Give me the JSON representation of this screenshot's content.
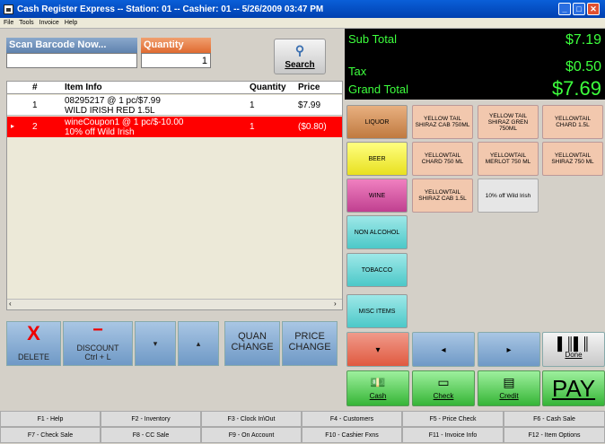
{
  "window": {
    "title": "Cash Register Express -- Station: 01 -- Cashier: 01 -- 5/26/2009 03:47 PM"
  },
  "menu": [
    "File",
    "Tools",
    "Invoice",
    "Help"
  ],
  "scan": {
    "label": "Scan Barcode Now...",
    "value": ""
  },
  "quantity": {
    "label": "Quantity",
    "value": "1"
  },
  "search": {
    "label": "Search"
  },
  "grid": {
    "headers": [
      "#",
      "Item Info",
      "Quantity",
      "Price"
    ],
    "rows": [
      {
        "num": "1",
        "line1": "08295217 @ 1 pc/$7.99",
        "line2": "WILD IRISH RED 1.5L",
        "qty": "1",
        "price": "$7.99",
        "selected": false
      },
      {
        "num": "2",
        "line1": "wineCoupon1 @ 1 pc/$-10.00",
        "line2": "10% off Wild Irish",
        "qty": "1",
        "price": "($0.80)",
        "selected": true
      }
    ]
  },
  "actions": {
    "delete": "DELETE",
    "discount_line1": "DISCOUNT",
    "discount_line2": "Ctrl + L",
    "quan_change": "QUAN CHANGE",
    "price_change": "PRICE CHANGE"
  },
  "totals": {
    "subtotal_label": "Sub Total",
    "subtotal": "$7.19",
    "tax_label": "Tax",
    "tax": "$0.50",
    "grand_label": "Grand Total",
    "grand": "$7.69"
  },
  "categories": [
    "LIQUOR",
    "BEER",
    "WINE",
    "NON ALCOHOL",
    "TOBACCO",
    "MISC ITEMS"
  ],
  "products": [
    [
      "YELLOW TAIL SHIRAZ CAB 750ML",
      "YELLOW TAIL SHIRAZ GREN 750ML",
      "YELLOWTAIL CHARD 1.5L"
    ],
    [
      "YELLOWTAIL CHARD 750 ML",
      "YELLOWTAIL MERLOT 750 ML",
      "YELLOWTAIL SHIRAZ 750 ML"
    ],
    [
      "YELLOWTAIL SHIRAZ CAB 1.5L",
      "10% off Wild Irish"
    ]
  ],
  "nav": {
    "done": "Done"
  },
  "payments": {
    "cash": "Cash",
    "check": "Check",
    "credit": "Credit",
    "pay": "PAY"
  },
  "fkeys": [
    [
      "F1 - Help",
      "F2 - Inventory",
      "F3 - Clock In\\Out",
      "F4 - Customers",
      "F5 - Price Check",
      "F6 - Cash Sale"
    ],
    [
      "F7 - Check Sale",
      "F8 - CC Sale",
      "F9 - On Account",
      "F10 - Cashier Fxns",
      "F11 - Invoice Info",
      "F12 - Item Options"
    ]
  ],
  "colors": {
    "accent_red": "#ff0000",
    "totals_green": "#3dff3d",
    "title_blue": "#0a5fd8"
  }
}
